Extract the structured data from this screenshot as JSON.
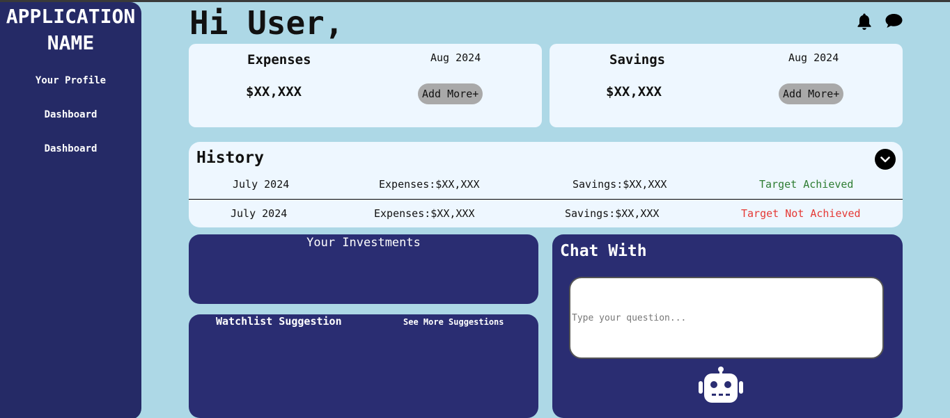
{
  "sidebar": {
    "app_name_line1": "APPLICATION",
    "app_name_line2": "NAME",
    "items": [
      {
        "label": "Your Profile"
      },
      {
        "label": "Dashboard"
      },
      {
        "label": "Dashboard"
      }
    ]
  },
  "header": {
    "greeting": "Hi User,",
    "icons": [
      "bell-icon",
      "chat-bubble-icon"
    ]
  },
  "cards": {
    "expenses": {
      "title": "Expenses",
      "month": "Aug 2024",
      "amount": "$XX,XXX",
      "button": "Add More+"
    },
    "savings": {
      "title": "Savings",
      "month": "Aug 2024",
      "amount": "$XX,XXX",
      "button": "Add More+"
    }
  },
  "history": {
    "title": "History",
    "rows": [
      {
        "month": "July 2024",
        "expenses": "Expenses:$XX,XXX",
        "savings": "Savings:$XX,XXX",
        "status": "Target Achieved"
      },
      {
        "month": "July 2024",
        "expenses": "Expenses:$XX,XXX",
        "savings": "Savings:$XX,XXX",
        "status": "Target Not Achieved"
      }
    ]
  },
  "investments": {
    "title": "Your Investments"
  },
  "watchlist": {
    "title": "Watchlist Suggestion",
    "more_link": "See More Suggestions"
  },
  "chat": {
    "title": "Chat With",
    "input_placeholder": "Type your question...",
    "bot_icon": "robot-icon"
  },
  "colors": {
    "background": "#add8e6",
    "sidebar": "#252a66",
    "panel": "#2a2d72",
    "card": "#eef7ff",
    "achieved": "#2e7d32",
    "not_achieved": "#e53935",
    "button": "#a9a9a9"
  }
}
